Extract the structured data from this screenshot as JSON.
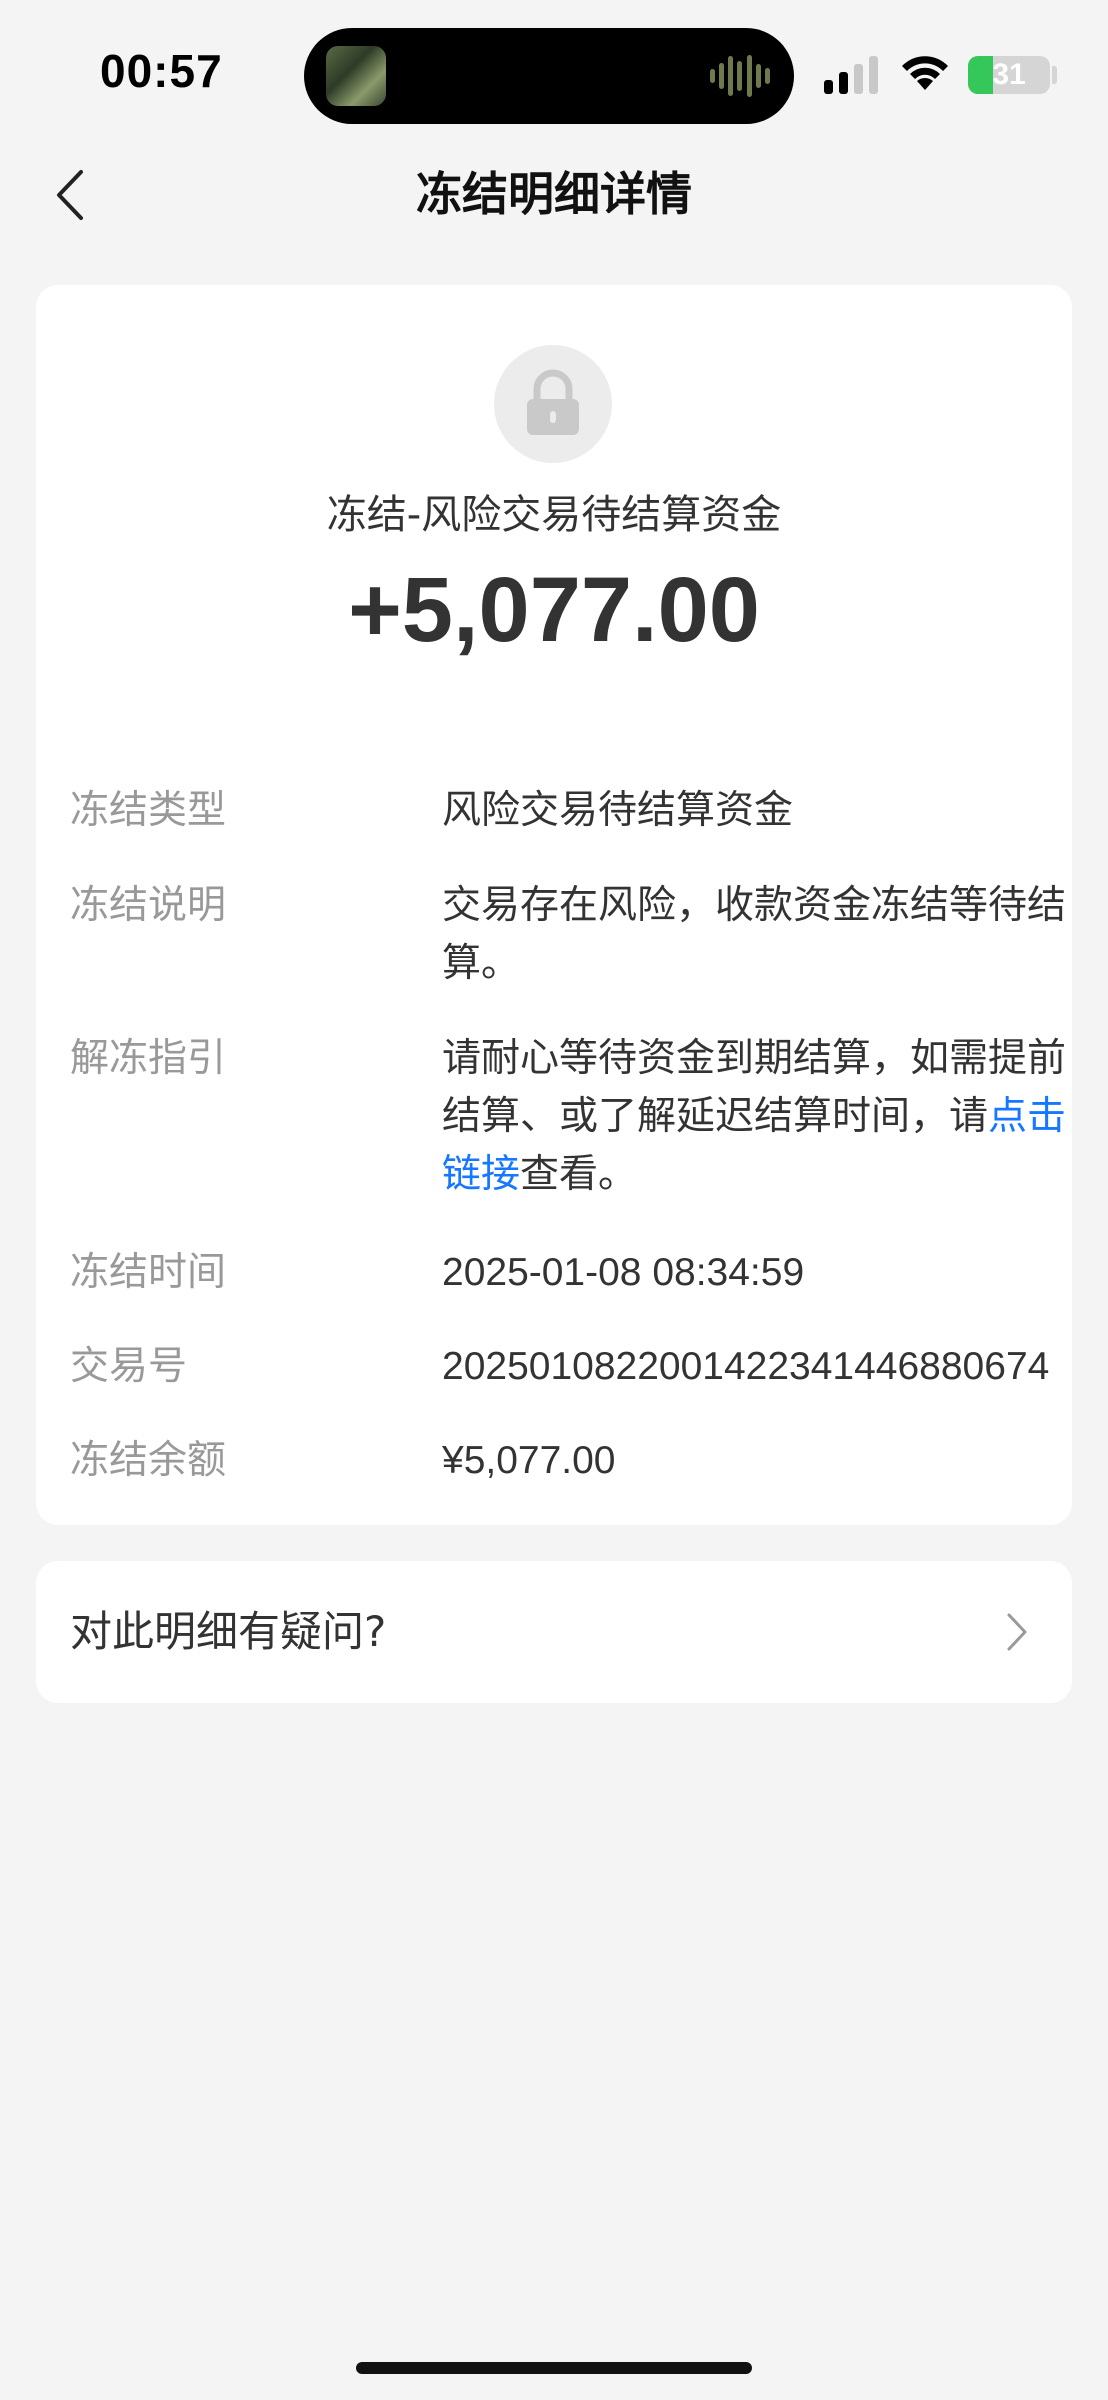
{
  "status_bar": {
    "time": "00:57",
    "battery": "31",
    "icons": [
      "cellular-signal-icon",
      "wifi-icon",
      "battery-charging-icon"
    ]
  },
  "nav": {
    "title": "冻结明细详情",
    "back_icon": "chevron-left-icon"
  },
  "summary": {
    "icon": "lock-icon",
    "headline": "冻结-风险交易待结算资金",
    "amount": "+5,077.00"
  },
  "details": {
    "type_label": "冻结类型",
    "type_value": "风险交易待结算资金",
    "desc_label": "冻结说明",
    "desc_value": "交易存在风险，收款资金冻结等待结算。",
    "guide_label": "解冻指引",
    "guide_prefix": "请耐心等待资金到期结算，如需提前结算、或了解延迟结算时间，请",
    "guide_link": "点击链接",
    "guide_suffix": "查看。",
    "time_label": "冻结时间",
    "time_value": "2025-01-08 08:34:59",
    "txn_label": "交易号",
    "txn_value": "2025010822001422341446880674",
    "balance_label": "冻结余额",
    "balance_value": "¥5,077.00"
  },
  "question": {
    "label": "对此明细有疑问?",
    "icon": "chevron-right-icon"
  },
  "colors": {
    "background": "#f4f4f4",
    "card": "#ffffff",
    "link": "#1677ff",
    "label": "#999999",
    "text": "#333333",
    "battery_green": "#35c759"
  }
}
